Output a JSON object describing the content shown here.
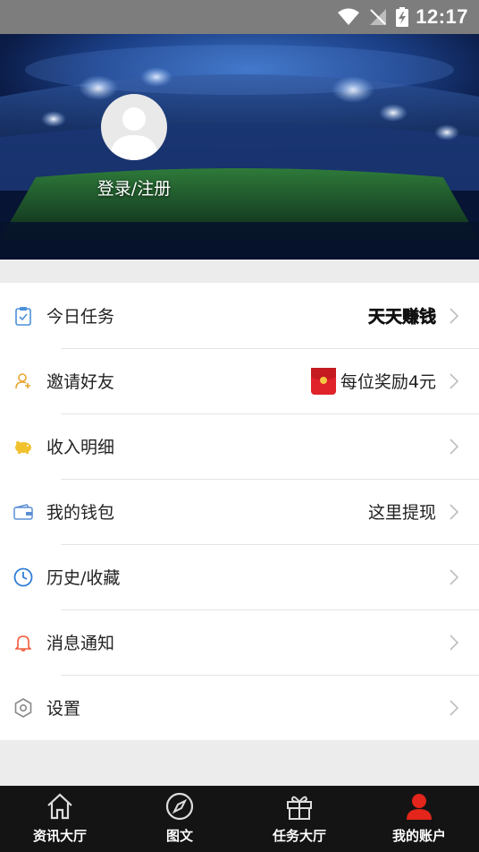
{
  "status_bar": {
    "time": "12:17",
    "icons": [
      "wifi-icon",
      "no-signal-icon",
      "battery-charging-icon"
    ]
  },
  "header": {
    "login_label": "登录/注册",
    "avatar_icon": "default-avatar-icon"
  },
  "menu": {
    "items": [
      {
        "icon": "clipboard-check-icon",
        "label": "今日任务",
        "right_text": "天天赚钱",
        "icon_color": "#4a90d9"
      },
      {
        "icon": "add-user-icon",
        "label": "邀请好友",
        "right_text": "每位奖励4元",
        "icon_color": "#e8a530",
        "right_icon": "red-envelope-icon"
      },
      {
        "icon": "piggy-bank-icon",
        "label": "收入明细",
        "right_text": "",
        "icon_color": "#f2c12e"
      },
      {
        "icon": "wallet-icon",
        "label": "我的钱包",
        "right_text": "这里提现",
        "icon_color": "#5b8fd6"
      },
      {
        "icon": "clock-icon",
        "label": "历史/收藏",
        "right_text": "",
        "icon_color": "#2f7ed8"
      },
      {
        "icon": "bell-icon",
        "label": "消息通知",
        "right_text": "",
        "icon_color": "#f05a3a"
      },
      {
        "icon": "gear-icon",
        "label": "设置",
        "right_text": "",
        "icon_color": "#888888"
      }
    ]
  },
  "tabs": [
    {
      "label": "资讯大厅",
      "icon": "home-icon",
      "active": false
    },
    {
      "label": "图文",
      "icon": "compass-icon",
      "active": false
    },
    {
      "label": "任务大厅",
      "icon": "gift-icon",
      "active": false
    },
    {
      "label": "我的账户",
      "icon": "user-icon",
      "active": true
    }
  ],
  "colors": {
    "accent_active": "#e3251b",
    "tab_bar_bg": "#141414",
    "page_bg": "#ececec"
  }
}
